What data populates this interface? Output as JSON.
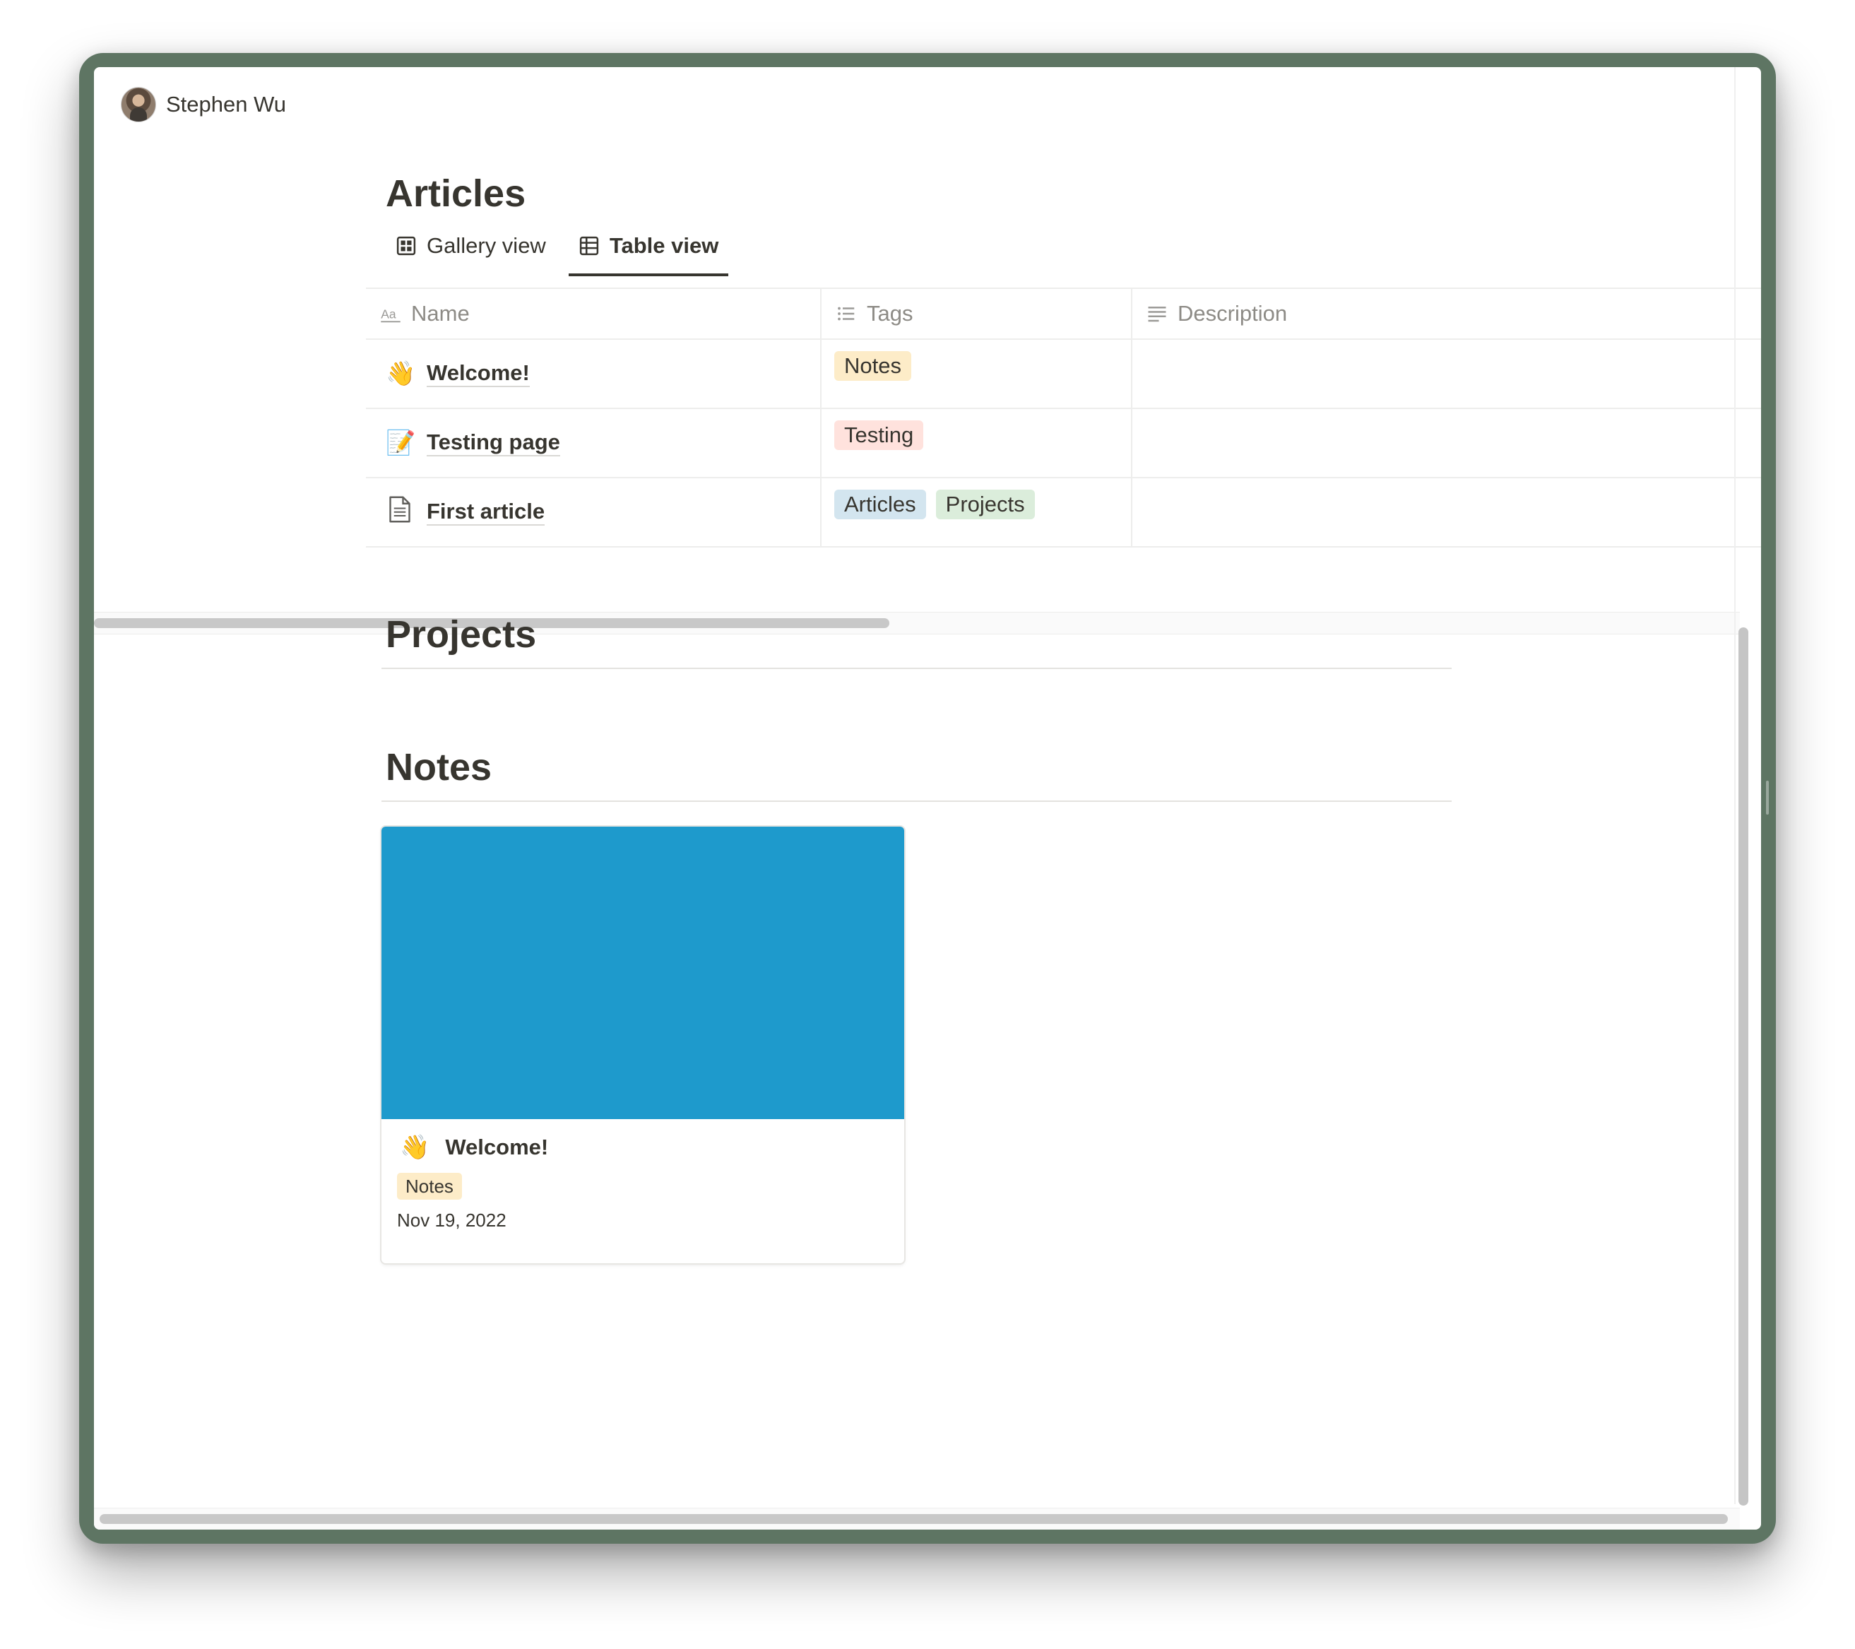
{
  "user": {
    "name": "Stephen Wu"
  },
  "articles": {
    "title": "Articles",
    "tabs": [
      {
        "label": "Gallery view",
        "icon": "gallery-icon",
        "active": false
      },
      {
        "label": "Table view",
        "icon": "table-icon",
        "active": true
      }
    ],
    "columns": [
      {
        "label": "Name",
        "icon": "text-property-icon"
      },
      {
        "label": "Tags",
        "icon": "list-property-icon"
      },
      {
        "label": "Description",
        "icon": "text-lines-icon"
      }
    ],
    "rows": [
      {
        "emoji": "👋",
        "icon": "waving-hand-icon",
        "name": "Welcome!",
        "tags": [
          "Notes"
        ],
        "description": ""
      },
      {
        "emoji": "📝",
        "icon": "memo-icon",
        "name": "Testing page",
        "tags": [
          "Testing"
        ],
        "description": ""
      },
      {
        "emoji": "",
        "icon": "document-icon",
        "name": "First article",
        "tags": [
          "Articles",
          "Projects"
        ],
        "description": ""
      }
    ]
  },
  "projects": {
    "title": "Projects"
  },
  "notes": {
    "title": "Notes",
    "cards": [
      {
        "emoji": "👋",
        "icon": "waving-hand-icon",
        "title": "Welcome!",
        "tag": "Notes",
        "date": "Nov 19, 2022",
        "cover_color": "#1e9acc"
      }
    ]
  },
  "colors": {
    "frame": "#5e7563",
    "tag_notes": "#fdecc8",
    "tag_testing": "#ffe2dd",
    "tag_articles": "#d3e5ef",
    "tag_projects": "#dbeddb"
  }
}
